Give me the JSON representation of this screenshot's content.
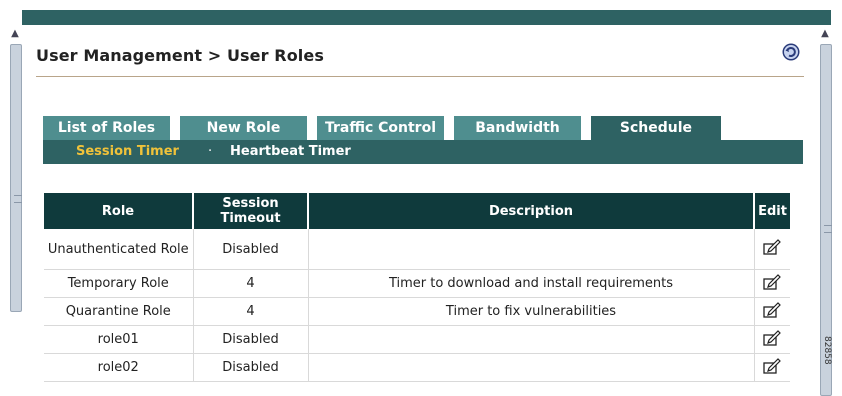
{
  "header": {
    "title": "User Management > User Roles"
  },
  "tabs": [
    {
      "label": "List of Roles"
    },
    {
      "label": "New Role"
    },
    {
      "label": "Traffic Control"
    },
    {
      "label": "Bandwidth"
    },
    {
      "label": "Schedule"
    }
  ],
  "subtabs": {
    "session_timer": "Session Timer",
    "separator": "·",
    "heartbeat_timer": "Heartbeat Timer"
  },
  "table": {
    "columns": [
      "Role",
      "Session Timeout",
      "Description",
      "Edit"
    ],
    "rows": [
      {
        "role": "Unauthenticated Role",
        "timeout": "Disabled",
        "description": ""
      },
      {
        "role": "Temporary Role",
        "timeout": "4",
        "description": "Timer to download and install requirements"
      },
      {
        "role": "Quarantine Role",
        "timeout": "4",
        "description": "Timer to fix vulnerabilities"
      },
      {
        "role": "role01",
        "timeout": "Disabled",
        "description": ""
      },
      {
        "role": "role02",
        "timeout": "Disabled",
        "description": ""
      }
    ]
  },
  "icons": {
    "refresh": "refresh-icon",
    "edit": "edit-icon"
  },
  "figure_code": "82858",
  "colors": {
    "header_bar": "#2e6263",
    "tab": "#4f8e8f",
    "table_header": "#0f3a3c",
    "active_subtab": "#f0c23a"
  }
}
